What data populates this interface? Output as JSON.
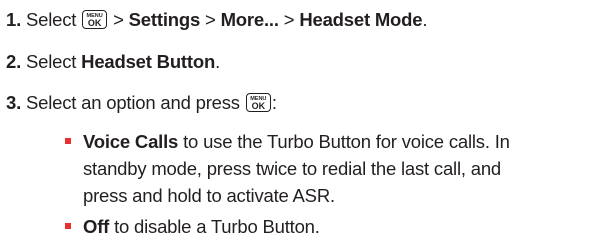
{
  "steps": [
    {
      "number": "1.",
      "text_before": "Select",
      "key": {
        "top": "MENU",
        "bottom": "OK"
      },
      "path": [
        {
          "sep": ">",
          "item": "Settings"
        },
        {
          "sep": ">",
          "item": "More..."
        },
        {
          "sep": ">",
          "item": "Headset Mode"
        }
      ],
      "end": "."
    },
    {
      "number": "2.",
      "text_before": "Select",
      "item": "Headset Button",
      "end": "."
    },
    {
      "number": "3.",
      "text_before": "Select an option and press",
      "key": {
        "top": "MENU",
        "bottom": "OK"
      },
      "end": ":"
    }
  ],
  "options": [
    {
      "label": "Voice Calls",
      "lines": [
        " to use the Turbo Button for voice calls. In",
        "standby mode, press twice to redial the last call, and",
        "press and hold to activate ASR."
      ]
    },
    {
      "label": "Off",
      "lines": [
        " to disable a Turbo Button."
      ]
    }
  ],
  "colors": {
    "text": "#231f20",
    "bullet": "#e8312f"
  }
}
